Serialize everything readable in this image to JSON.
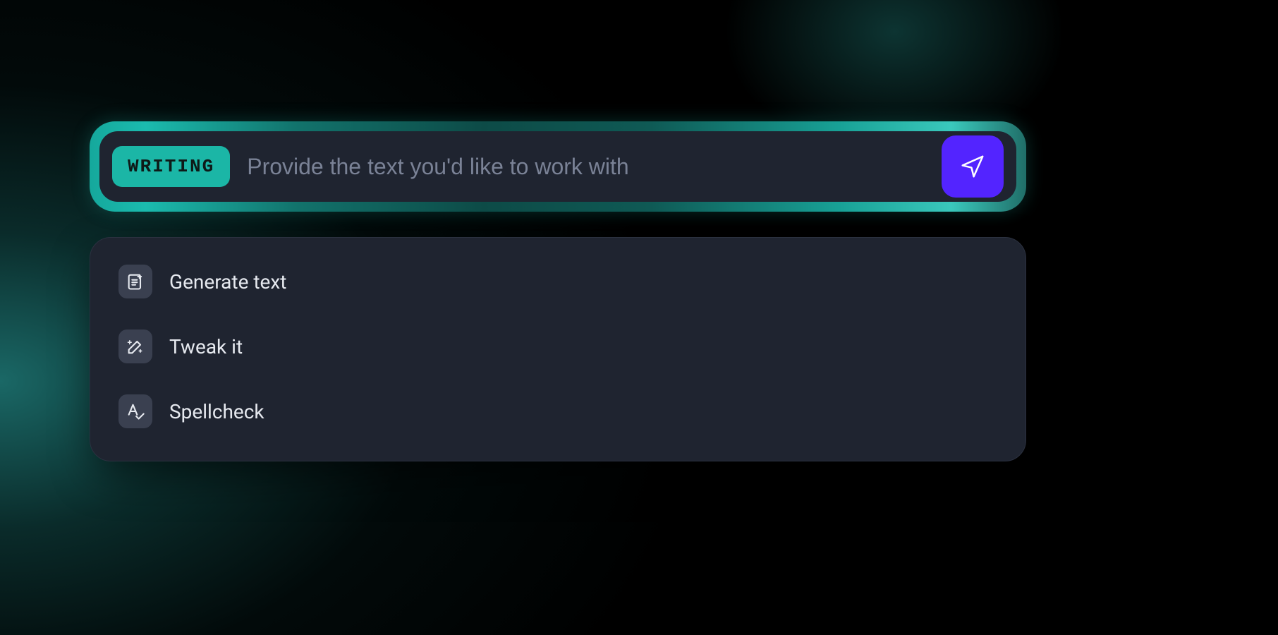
{
  "input": {
    "mode_badge": "WRITING",
    "placeholder": "Provide the text you'd like to work with",
    "value": ""
  },
  "suggestions": {
    "items": [
      {
        "label": "Generate text",
        "icon": "document-plus-icon"
      },
      {
        "label": "Tweak it",
        "icon": "magic-wand-icon"
      },
      {
        "label": "Spellcheck",
        "icon": "spellcheck-icon"
      }
    ]
  },
  "colors": {
    "accent_teal": "#1bb6a6",
    "accent_indigo": "#5324ff",
    "panel_bg": "#1f2430",
    "icon_box_bg": "#3a4050"
  }
}
